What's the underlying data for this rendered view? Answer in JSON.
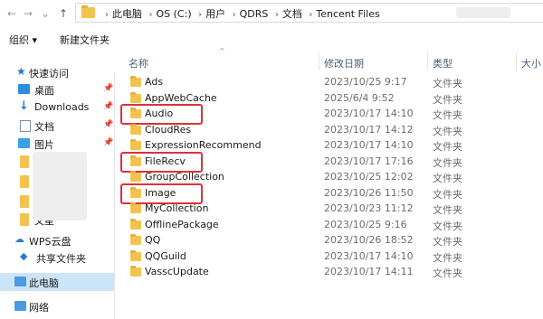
{
  "nav": {
    "back": "←",
    "forward": "→",
    "dropdown": "⌄",
    "up": "↑"
  },
  "breadcrumb": [
    "此电脑",
    "OS (C:)",
    "用户",
    "QDRS",
    "文档",
    "Tencent Files"
  ],
  "command_bar": {
    "organize": "组织 ▾",
    "new_folder": "新建文件夹"
  },
  "columns": {
    "name": "名称",
    "modified": "修改日期",
    "type": "类型",
    "size": "大小"
  },
  "sidebar": {
    "quick_access": "快速访问",
    "items": [
      {
        "label": "桌面",
        "icon": "desktop-icon",
        "pinned": true
      },
      {
        "label": "Downloads",
        "icon": "download-icon",
        "pinned": true
      },
      {
        "label": "文档",
        "icon": "document-icon",
        "pinned": true
      },
      {
        "label": "图片",
        "icon": "picture-icon",
        "pinned": true
      }
    ],
    "partial_label": "文星",
    "wps": "WPS云盘",
    "shared": "共享文件夹",
    "this_pc": "此电脑",
    "network": "网络"
  },
  "files": [
    {
      "name": "Ads",
      "date": "2023/10/25 9:17",
      "type": "文件夹"
    },
    {
      "name": "AppWebCache",
      "date": "2025/6/4 9:52",
      "type": "文件夹"
    },
    {
      "name": "Audio",
      "date": "2023/10/17 14:10",
      "type": "文件夹",
      "highlighted": true
    },
    {
      "name": "CloudRes",
      "date": "2023/10/17 14:12",
      "type": "文件夹"
    },
    {
      "name": "ExpressionRecommend",
      "date": "2023/10/17 14:10",
      "type": "文件夹"
    },
    {
      "name": "FileRecv",
      "date": "2023/10/17 17:16",
      "type": "文件夹",
      "highlighted": true
    },
    {
      "name": "GroupCollection",
      "date": "2023/10/25 12:02",
      "type": "文件夹"
    },
    {
      "name": "Image",
      "date": "2023/10/26 11:50",
      "type": "文件夹",
      "highlighted": true
    },
    {
      "name": "MyCollection",
      "date": "2023/10/23 11:12",
      "type": "文件夹"
    },
    {
      "name": "OfflinePackage",
      "date": "2023/10/25 9:16",
      "type": "文件夹"
    },
    {
      "name": "QQ",
      "date": "2023/10/26 18:52",
      "type": "文件夹"
    },
    {
      "name": "QQGuild",
      "date": "2023/10/17 14:10",
      "type": "文件夹"
    },
    {
      "name": "VasscUpdate",
      "date": "2023/10/17 14:11",
      "type": "文件夹"
    }
  ],
  "colors": {
    "folder": "#f3c34f",
    "highlight": "#e0303a",
    "selected": "#cce4f7",
    "accent": "#1e78d4"
  }
}
